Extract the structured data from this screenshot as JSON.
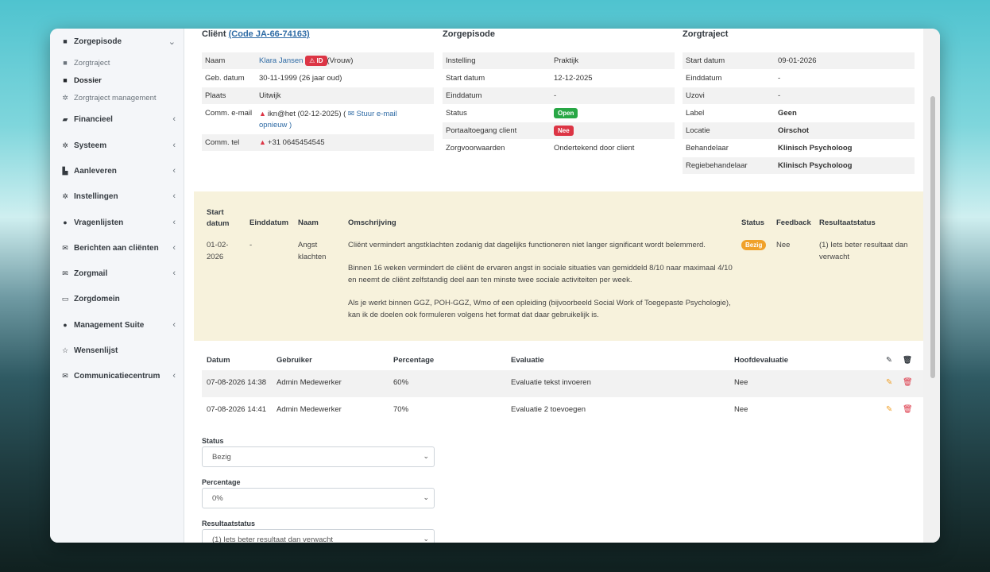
{
  "sidebar": {
    "items": [
      {
        "label": "Zorgepisode",
        "icon": "briefcase-icon",
        "chevron": "⌄"
      },
      {
        "label": "Zorgtraject",
        "icon": "briefcase-icon"
      },
      {
        "label": "Dossier",
        "icon": "briefcase-icon"
      },
      {
        "label": "Zorgtraject management",
        "icon": "gear-icon"
      },
      {
        "label": "Financieel",
        "icon": "book-icon",
        "chevron": "‹"
      },
      {
        "label": "Systeem",
        "icon": "gears-icon",
        "chevron": "‹"
      },
      {
        "label": "Aanleveren",
        "icon": "truck-icon",
        "chevron": "‹"
      },
      {
        "label": "Instellingen",
        "icon": "gear-icon",
        "chevron": "‹"
      },
      {
        "label": "Vragenlijsten",
        "icon": "globe-icon",
        "chevron": "‹"
      },
      {
        "label": "Berichten aan cliënten",
        "icon": "envelope-icon",
        "chevron": "‹"
      },
      {
        "label": "Zorgmail",
        "icon": "envelope-icon",
        "chevron": "‹"
      },
      {
        "label": "Zorgdomein",
        "icon": "inbox-icon"
      },
      {
        "label": "Management Suite",
        "icon": "globe-icon",
        "chevron": "‹"
      },
      {
        "label": "Wensenlijst",
        "icon": "star-icon"
      },
      {
        "label": "Communicatiecentrum",
        "icon": "envelope-icon",
        "chevron": "‹"
      }
    ]
  },
  "client": {
    "title": "Cliënt",
    "code": "(Code JA-66-74163)",
    "naam_label": "Naam",
    "naam": "Klara Jansen",
    "id_badge": "ID",
    "gender": "(Vrouw)",
    "geb_label": "Geb. datum",
    "geb": "30-11-1999 (26 jaar oud)",
    "plaats_label": "Plaats",
    "plaats": "Uitwijk",
    "email_label": "Comm. e-mail",
    "email": "ikn@het (02-12-2025) (",
    "email_link": "Stuur e-mail opnieuw",
    "email_close": ")",
    "tel_label": "Comm. tel",
    "tel": "+31 0645454545"
  },
  "episode": {
    "title": "Zorgepisode",
    "rows": [
      {
        "label": "Instelling",
        "value": "Praktijk"
      },
      {
        "label": "Start datum",
        "value": "12-12-2025"
      },
      {
        "label": "Einddatum",
        "value": "-"
      },
      {
        "label": "Status",
        "value": "Open"
      },
      {
        "label": "Portaaltoegang client",
        "value": "Nee"
      },
      {
        "label": "Zorgvoorwaarden",
        "value": "Ondertekend door client"
      }
    ]
  },
  "traject": {
    "title": "Zorgtraject",
    "rows": [
      {
        "label": "Start datum",
        "value": "09-01-2026"
      },
      {
        "label": "Einddatum",
        "value": "-"
      },
      {
        "label": "Uzovi",
        "value": "-"
      },
      {
        "label": "Label",
        "value": "Geen"
      },
      {
        "label": "Locatie",
        "value": "Oirschot"
      },
      {
        "label": "Behandelaar",
        "value": "Klinisch Psycholoog"
      },
      {
        "label": "Regiebehandelaar",
        "value": "Klinisch Psycholoog"
      }
    ]
  },
  "goals": {
    "headers": {
      "start": "Start datum",
      "eind": "Einddatum",
      "naam": "Naam",
      "omschrijving": "Omschrijving",
      "status": "Status",
      "feedback": "Feedback",
      "resultaat": "Resultaatstatus"
    },
    "row": {
      "start": "01-02-2026",
      "eind": "-",
      "naam": "Angst klachten",
      "p1": "Cliënt vermindert angstklachten zodanig dat dagelijks functioneren niet langer significant wordt belemmerd.",
      "p2": "Binnen 16 weken vermindert de cliënt de ervaren angst in sociale situaties van gemiddeld 8/10 naar maximaal 4/10 en neemt de cliënt zelfstandig deel aan ten minste twee sociale activiteiten per week.",
      "p3": "Als je werkt binnen GGZ, POH-GGZ, Wmo of een opleiding (bijvoorbeeld Social Work of Toegepaste Psychologie), kan ik de doelen ook formuleren volgens het format dat daar gebruikelijk is.",
      "status": "Bezig",
      "feedback": "Nee",
      "resultaat": "(1) Iets beter resultaat dan verwacht"
    }
  },
  "evaluations": {
    "headers": {
      "datum": "Datum",
      "gebruiker": "Gebruiker",
      "percentage": "Percentage",
      "evaluatie": "Evaluatie",
      "hoofd": "Hoofdevaluatie"
    },
    "rows": [
      {
        "datum": "07-08-2026 14:38",
        "gebruiker": "Admin Medewerker",
        "percentage": "60%",
        "evaluatie": "Evaluatie tekst invoeren",
        "hoofd": "Nee"
      },
      {
        "datum": "07-08-2026 14:41",
        "gebruiker": "Admin Medewerker",
        "percentage": "70%",
        "evaluatie": "Evaluatie 2 toevoegen",
        "hoofd": "Nee"
      }
    ]
  },
  "form": {
    "status_label": "Status",
    "status_value": "Bezig",
    "percentage_label": "Percentage",
    "percentage_value": "0%",
    "resultaat_label": "Resultaatstatus",
    "resultaat_value": "(1) Iets beter resultaat dan verwacht"
  }
}
